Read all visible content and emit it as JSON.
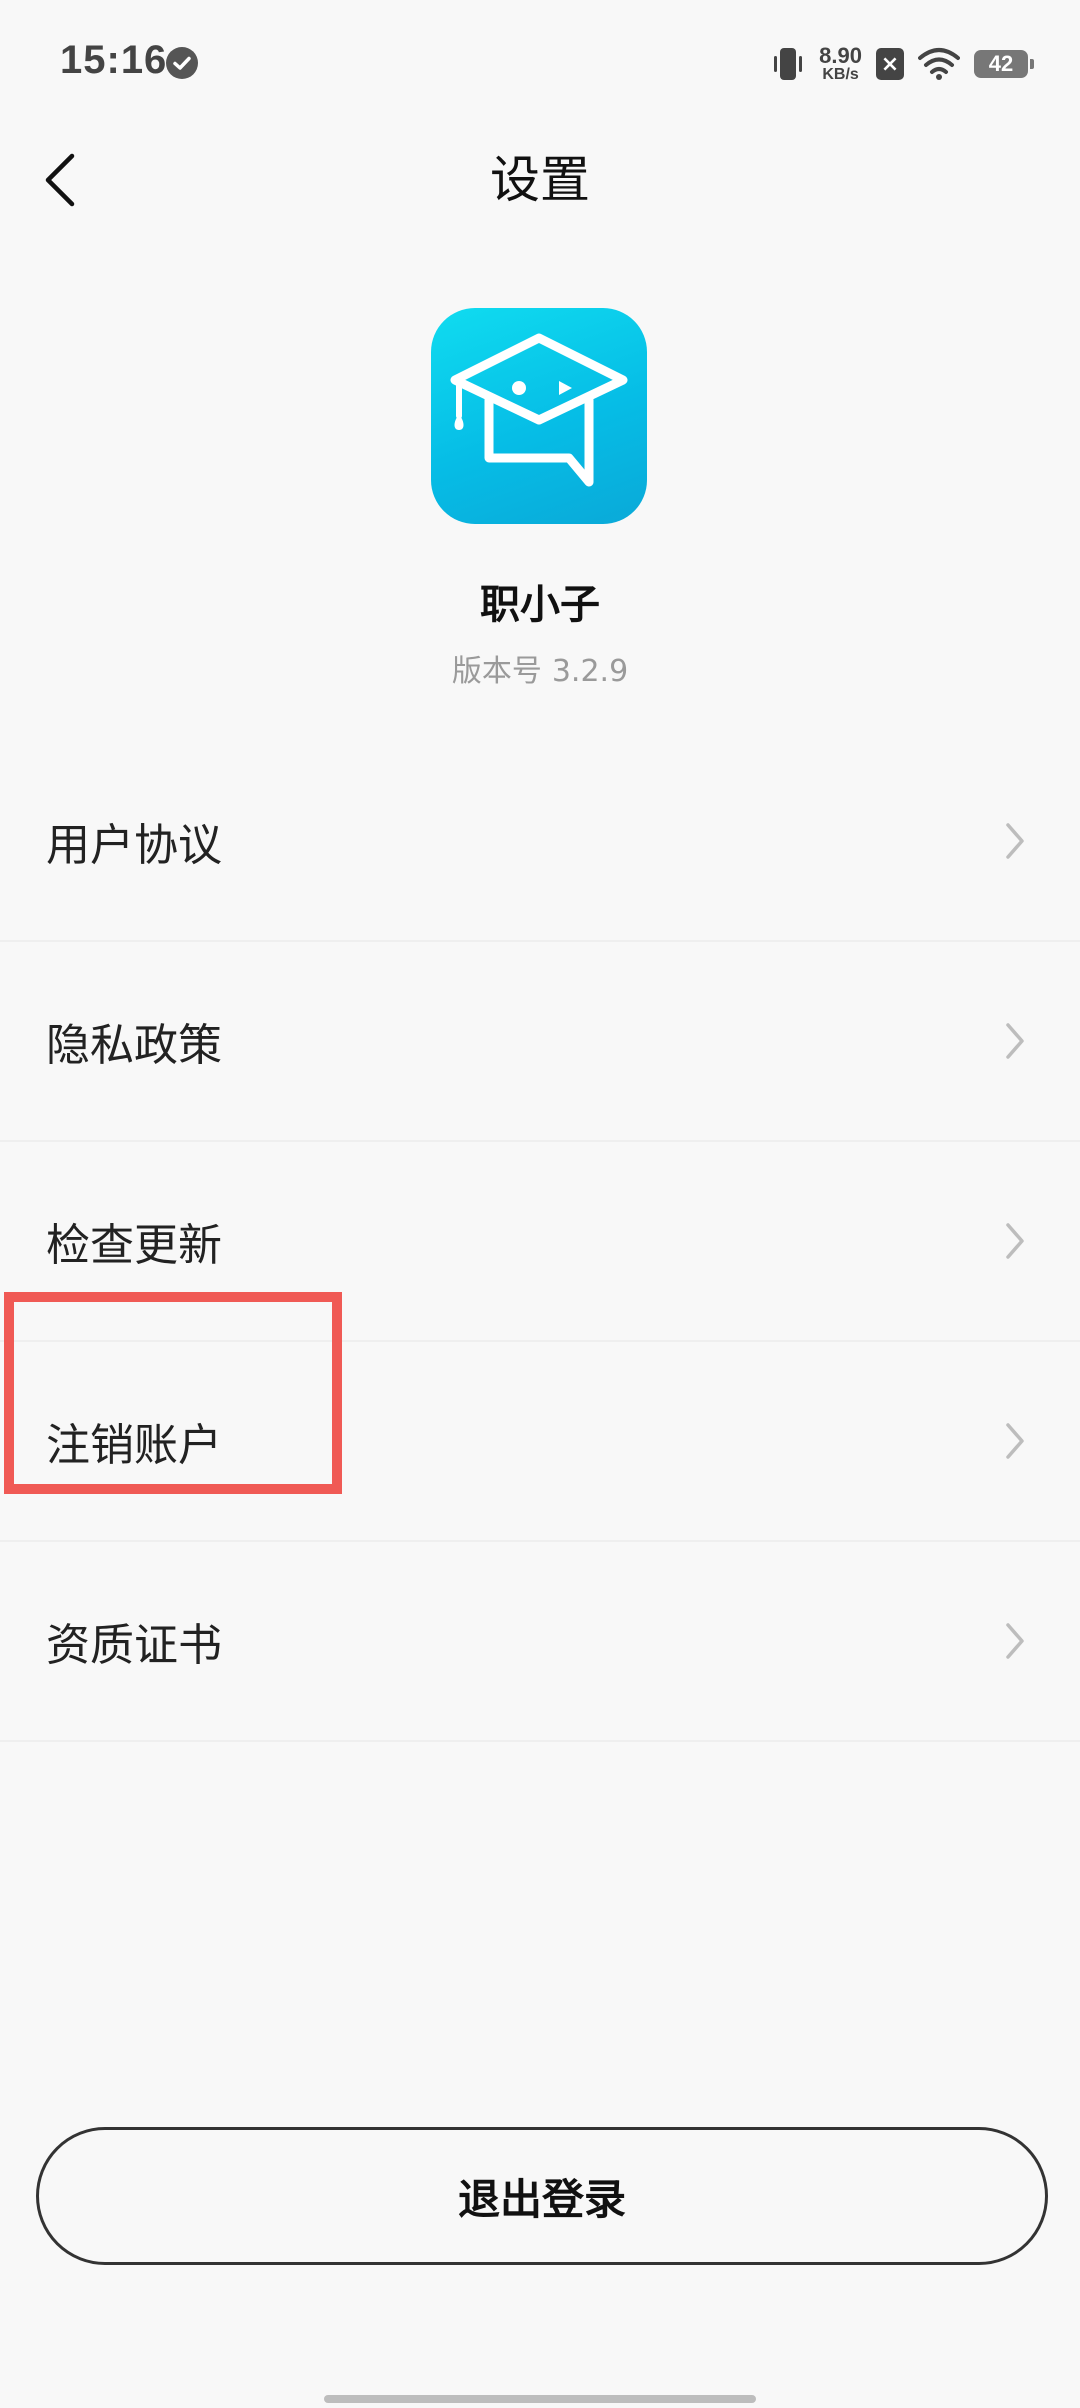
{
  "status_bar": {
    "time": "15:16",
    "net_speed_value": "8.90",
    "net_speed_unit": "KB/s",
    "battery_level": "42"
  },
  "header": {
    "title": "设置"
  },
  "app": {
    "name": "职小子",
    "version_label": "版本号",
    "version_number": "3.2.9",
    "logo_color": "#06bde6"
  },
  "menu": {
    "items": [
      {
        "label": "用户协议"
      },
      {
        "label": "隐私政策"
      },
      {
        "label": "检查更新"
      },
      {
        "label": "注销账户"
      },
      {
        "label": "资质证书"
      }
    ]
  },
  "highlight": {
    "target": "注销账户",
    "color": "#f05a55"
  },
  "logout": {
    "label": "退出登录"
  }
}
